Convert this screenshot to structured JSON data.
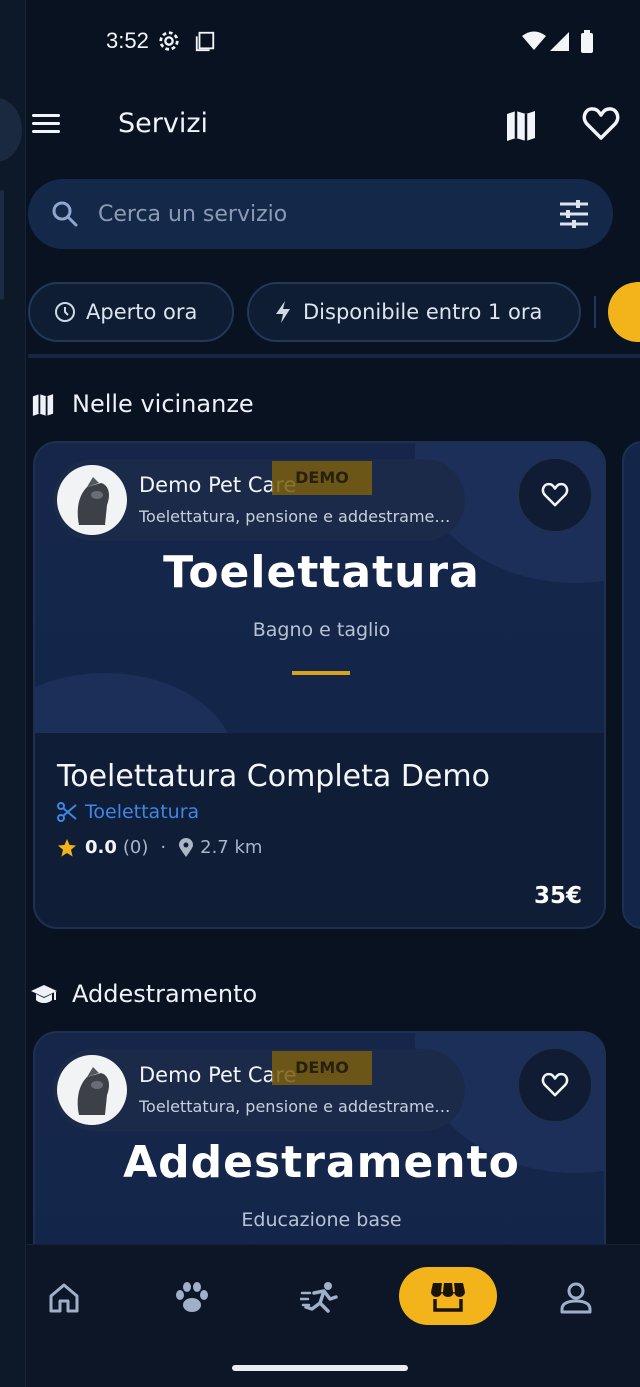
{
  "status_bar": {
    "time": "3:52"
  },
  "app_bar": {
    "title": "Servizi"
  },
  "search": {
    "placeholder": "Cerca un servizio"
  },
  "filters": {
    "chips": [
      "Aperto ora",
      "Disponibile entro 1 ora"
    ]
  },
  "sections": [
    {
      "title": "Nelle vicinanze",
      "icon": "map-icon",
      "card": {
        "provider_name": "Demo Pet Care",
        "provider_description": "Toelettatura, pensione e addestramento",
        "badge": "DEMO",
        "hero_title": "Toelettatura",
        "hero_subtitle": "Bagno e taglio",
        "service_title": "Toelettatura Completa Demo",
        "category": "Toelettatura",
        "rating": "0.0",
        "reviews": "(0)",
        "separator": "·",
        "distance": "2.7 km",
        "price": "35€"
      }
    },
    {
      "title": "Addestramento",
      "icon": "graduation-cap-icon",
      "card": {
        "provider_name": "Demo Pet Care",
        "provider_description": "Toelettatura, pensione e addestramento",
        "badge": "DEMO",
        "hero_title": "Addestramento",
        "hero_subtitle": "Educazione base"
      }
    }
  ],
  "bottom_nav": {
    "items": [
      "home-icon",
      "paw-icon",
      "running-icon",
      "store-icon",
      "profile-icon"
    ],
    "active": "store-icon"
  },
  "colors": {
    "accent": "#f3b41b",
    "background": "#091220",
    "link": "#3f86e6"
  }
}
